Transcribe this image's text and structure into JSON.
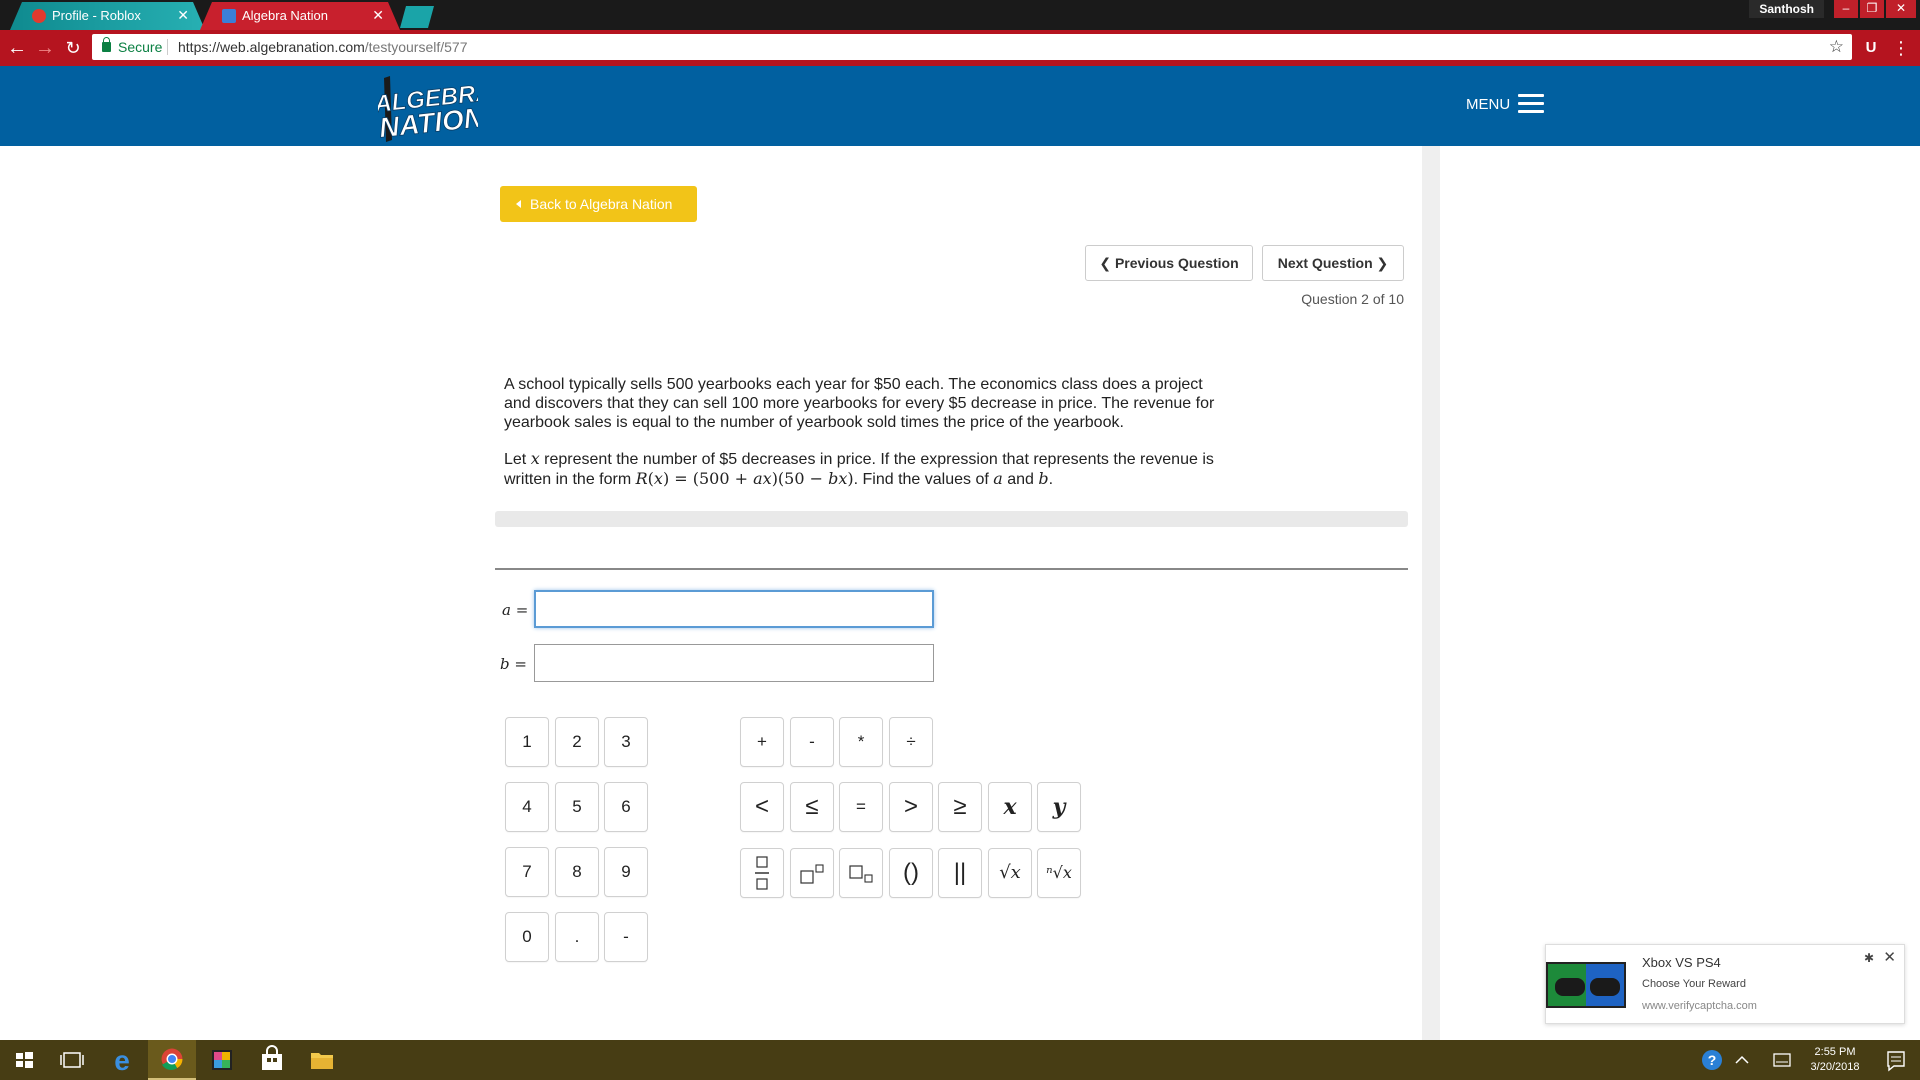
{
  "browser": {
    "tabs": [
      {
        "title": "Profile - Roblox",
        "active": false
      },
      {
        "title": "Algebra Nation",
        "active": true
      }
    ],
    "profile_name": "Santhosh",
    "secure_label": "Secure",
    "url_main": "https://web.algebranation.com",
    "url_path": "/testyourself/577",
    "extension_label": "U",
    "window_controls": [
      "–",
      "❐",
      "✕"
    ]
  },
  "header": {
    "logo_line1": "ALGEBRA",
    "logo_line2": "NATION",
    "menu_label": "MENU"
  },
  "content": {
    "back_label": "Back to Algebra Nation",
    "prev_label": "Previous Question",
    "next_label": "Next Question",
    "counter": "Question 2 of 10",
    "question": {
      "p1": "A school typically sells 500 yearbooks each year for $50 each. The economics class does a project and discovers that they can sell 100 more yearbooks for every $5 decrease in price. The revenue for yearbook sales is equal to the number of yearbook sold times the price of the yearbook.",
      "p2_a": "Let ",
      "p2_var": "x",
      "p2_b": " represent the number of $5 decreases in price. If the expression that represents the revenue is written in the form ",
      "p2_expr_R": "R",
      "p2_expr_paren": "(",
      "p2_expr_x": "x",
      "p2_expr_rest": ") = (500 + ",
      "p2_expr_ax": "ax",
      "p2_expr_mid": ")(50 − ",
      "p2_expr_bx": "bx",
      "p2_expr_end": ")",
      "p2_c": ". Find the values of ",
      "p2_a_var": "a",
      "p2_and": " and ",
      "p2_b_var": "b",
      "p2_end": "."
    },
    "inputs": {
      "a_label": "a",
      "b_label": "b",
      "eq": " =",
      "a_value": "",
      "b_value": ""
    }
  },
  "keypad": {
    "digits": [
      "1",
      "2",
      "3",
      "4",
      "5",
      "6",
      "7",
      "8",
      "9",
      "0",
      ".",
      "-"
    ],
    "operators": [
      "+",
      "-",
      "*",
      "÷"
    ],
    "relations": [
      "<",
      "≤",
      "=",
      ">",
      "≥",
      "x",
      "y"
    ],
    "templates": {
      "fraction": "fraction-template-icon",
      "superscript": "superscript-template-icon",
      "subscript": "subscript-template-icon",
      "parens": "()",
      "abs": "||",
      "sqrt": "√x",
      "nthroot": "ⁿ√x"
    }
  },
  "notification": {
    "title": "Xbox VS PS4",
    "subtitle": "Choose Your Reward",
    "url": "www.verifycaptcha.com"
  },
  "taskbar": {
    "time": "2:55 PM",
    "date": "3/20/2018"
  }
}
